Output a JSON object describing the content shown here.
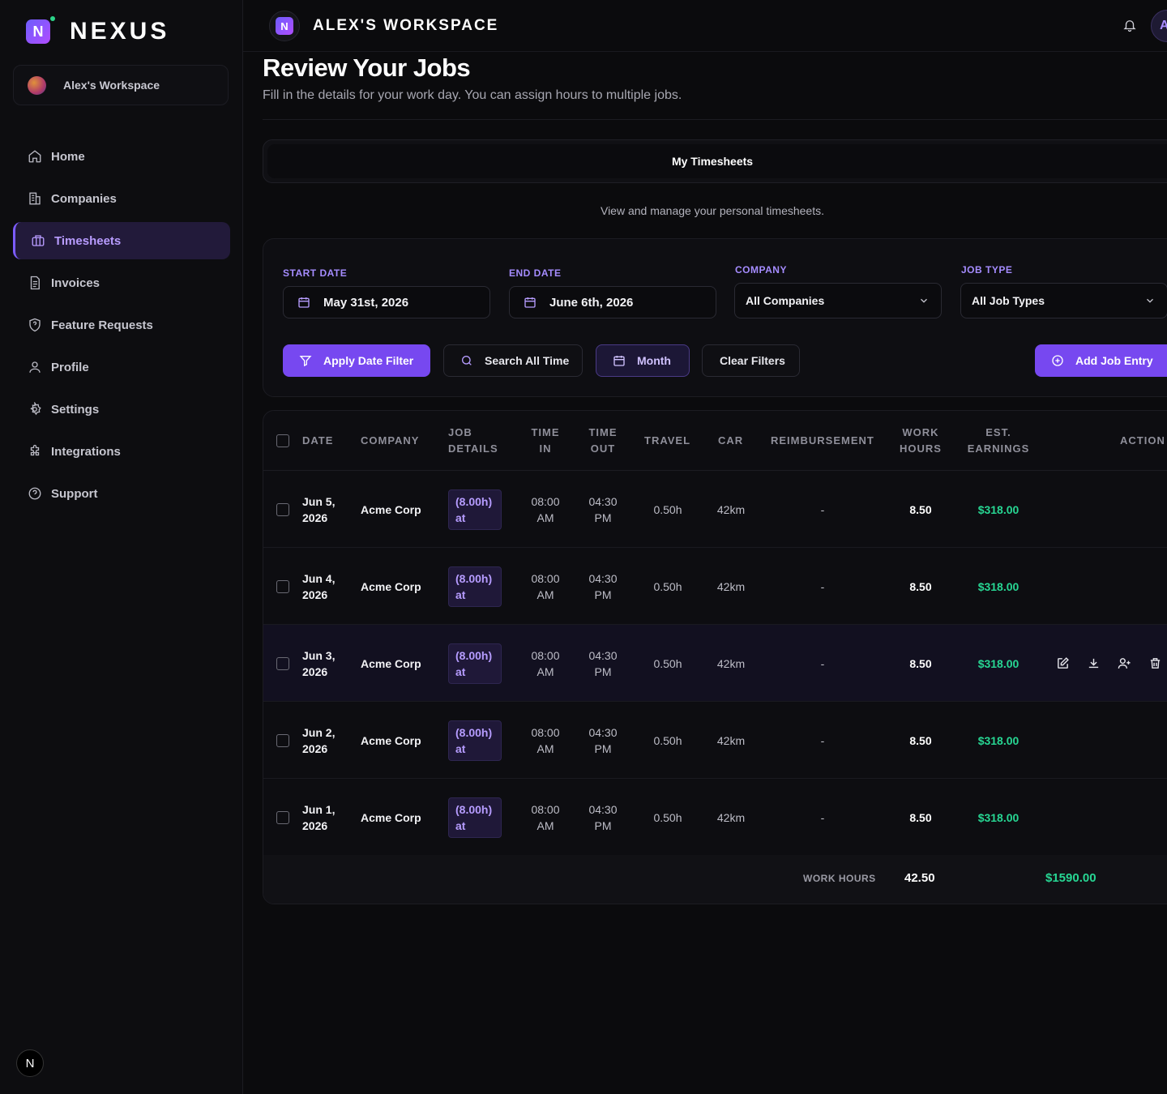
{
  "brand": {
    "name": "NEXUS",
    "mark": "N"
  },
  "workspace": {
    "name": "Alex's Workspace",
    "title": "ALEX'S WORKSPACE",
    "avatar_letter": "A"
  },
  "nav": [
    {
      "label": "Home",
      "icon": "home-icon"
    },
    {
      "label": "Companies",
      "icon": "building-icon"
    },
    {
      "label": "Timesheets",
      "icon": "briefcase-icon",
      "active": true
    },
    {
      "label": "Invoices",
      "icon": "document-icon"
    },
    {
      "label": "Feature Requests",
      "icon": "shield-question-icon"
    },
    {
      "label": "Profile",
      "icon": "user-icon"
    },
    {
      "label": "Settings",
      "icon": "gear-icon"
    },
    {
      "label": "Integrations",
      "icon": "puzzle-icon"
    },
    {
      "label": "Support",
      "icon": "help-circle-icon"
    }
  ],
  "footer_badge": "N",
  "page": {
    "title": "Review Your Jobs",
    "subtitle": "Fill in the details for your work day. You can assign hours to multiple jobs.",
    "tab": "My Timesheets",
    "tab_description": "View and manage your personal timesheets."
  },
  "filters": {
    "start_label": "START DATE",
    "start_value": "May 31st, 2026",
    "end_label": "END DATE",
    "end_value": "June 6th, 2026",
    "company_label": "COMPANY",
    "company_value": "All Companies",
    "jobtype_label": "JOB TYPE",
    "jobtype_value": "All Job Types",
    "apply": "Apply Date Filter",
    "search_all": "Search All Time",
    "month": "Month",
    "clear": "Clear Filters",
    "add": "Add Job Entry"
  },
  "table": {
    "headers": {
      "date": "DATE",
      "company": "COMPANY",
      "job1": "JOB",
      "job2": "DETAILS",
      "tin1": "TIME",
      "tin2": "IN",
      "tout1": "TIME",
      "tout2": "OUT",
      "travel": "TRAVEL",
      "car": "CAR",
      "reimb": "REIMBURSEMENT",
      "wh1": "WORK",
      "wh2": "HOURS",
      "ee1": "EST.",
      "ee2": "EARNINGS",
      "action": "ACTION"
    },
    "rows": [
      {
        "date1": "Jun 5,",
        "date2": "2026",
        "company": "Acme Corp",
        "job1": "(8.00h)",
        "job2": "at",
        "tin1": "08:00",
        "tin2": "AM",
        "tout1": "04:30",
        "tout2": "PM",
        "travel": "0.50h",
        "car": "42km",
        "reimb": "-",
        "hours": "8.50",
        "earnings": "$318.00"
      },
      {
        "date1": "Jun 4,",
        "date2": "2026",
        "company": "Acme Corp",
        "job1": "(8.00h)",
        "job2": "at",
        "tin1": "08:00",
        "tin2": "AM",
        "tout1": "04:30",
        "tout2": "PM",
        "travel": "0.50h",
        "car": "42km",
        "reimb": "-",
        "hours": "8.50",
        "earnings": "$318.00"
      },
      {
        "date1": "Jun 3,",
        "date2": "2026",
        "company": "Acme Corp",
        "job1": "(8.00h)",
        "job2": "at",
        "tin1": "08:00",
        "tin2": "AM",
        "tout1": "04:30",
        "tout2": "PM",
        "travel": "0.50h",
        "car": "42km",
        "reimb": "-",
        "hours": "8.50",
        "earnings": "$318.00"
      },
      {
        "date1": "Jun 2,",
        "date2": "2026",
        "company": "Acme Corp",
        "job1": "(8.00h)",
        "job2": "at",
        "tin1": "08:00",
        "tin2": "AM",
        "tout1": "04:30",
        "tout2": "PM",
        "travel": "0.50h",
        "car": "42km",
        "reimb": "-",
        "hours": "8.50",
        "earnings": "$318.00"
      },
      {
        "date1": "Jun 1,",
        "date2": "2026",
        "company": "Acme Corp",
        "job1": "(8.00h)",
        "job2": "at",
        "tin1": "08:00",
        "tin2": "AM",
        "tout1": "04:30",
        "tout2": "PM",
        "travel": "0.50h",
        "car": "42km",
        "reimb": "-",
        "hours": "8.50",
        "earnings": "$318.00"
      }
    ],
    "footer": {
      "label": "WORK HOURS",
      "total_hours": "42.50",
      "total_earnings": "$1590.00"
    }
  },
  "colors": {
    "accent": "#7748f0",
    "accent_text": "#a58cff",
    "earnings": "#27d693",
    "background": "#0b0b0d"
  }
}
